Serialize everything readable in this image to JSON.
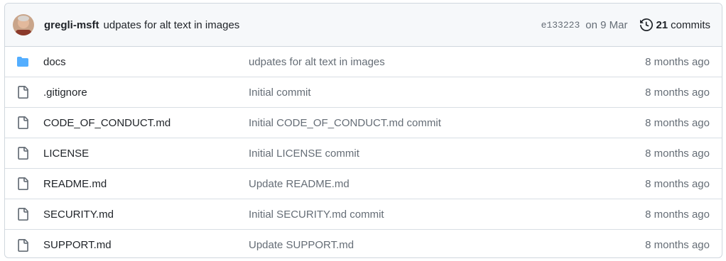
{
  "latest_commit": {
    "author": "gregli-msft",
    "message": "udpates for alt text in images",
    "sha": "e133223",
    "date": "on 9 Mar",
    "commit_count": "21",
    "commits_label": "commits"
  },
  "files": [
    {
      "type": "directory",
      "name": "docs",
      "message": "udpates for alt text in images",
      "age": "8 months ago"
    },
    {
      "type": "file",
      "name": ".gitignore",
      "message": "Initial commit",
      "age": "8 months ago"
    },
    {
      "type": "file",
      "name": "CODE_OF_CONDUCT.md",
      "message": "Initial CODE_OF_CONDUCT.md commit",
      "age": "8 months ago"
    },
    {
      "type": "file",
      "name": "LICENSE",
      "message": "Initial LICENSE commit",
      "age": "8 months ago"
    },
    {
      "type": "file",
      "name": "README.md",
      "message": "Update README.md",
      "age": "8 months ago"
    },
    {
      "type": "file",
      "name": "SECURITY.md",
      "message": "Initial SECURITY.md commit",
      "age": "8 months ago"
    },
    {
      "type": "file",
      "name": "SUPPORT.md",
      "message": "Update SUPPORT.md",
      "age": "8 months ago"
    }
  ],
  "colors": {
    "folder": "#54aeff",
    "file_icon": "#656d76",
    "muted_text": "#656d76",
    "border": "#d0d7de",
    "header_bg": "#f6f8fa"
  }
}
